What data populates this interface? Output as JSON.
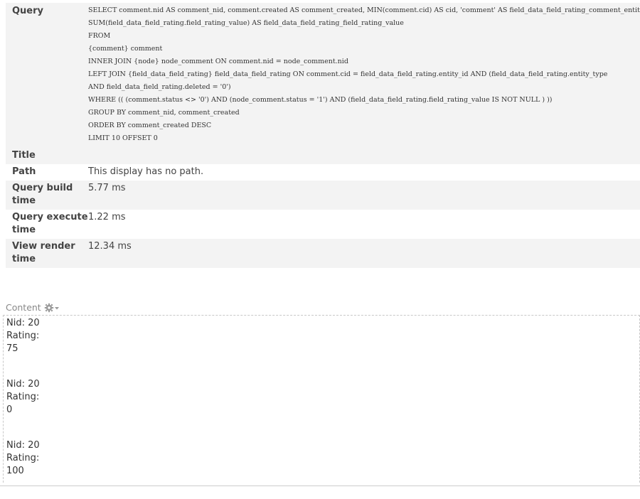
{
  "preview": {
    "rows": [
      {
        "label": "Query",
        "sql": [
          "SELECT comment.nid AS comment_nid, comment.created AS comment_created, MIN(comment.cid) AS cid, 'comment' AS field_data_field_rating_comment_entity_type,",
          "SUM(field_data_field_rating.field_rating_value) AS field_data_field_rating_field_rating_value",
          "FROM",
          "{comment} comment",
          "INNER JOIN {node} node_comment ON comment.nid = node_comment.nid",
          "LEFT JOIN {field_data_field_rating} field_data_field_rating ON comment.cid = field_data_field_rating.entity_id AND (field_data_field_rating.entity_type",
          "AND field_data_field_rating.deleted = '0')",
          "WHERE (( (comment.status <> '0') AND (node_comment.status = '1') AND (field_data_field_rating.field_rating_value IS NOT NULL ) ))",
          "GROUP BY comment_nid, comment_created",
          "ORDER BY comment_created DESC",
          "LIMIT 10 OFFSET 0"
        ]
      },
      {
        "label": "Title",
        "value": ""
      },
      {
        "label": "Path",
        "value": "This display has no path."
      },
      {
        "label": "Query build time",
        "value": "5.77 ms"
      },
      {
        "label": "Query execute time",
        "value": "1.22 ms"
      },
      {
        "label": "View render time",
        "value": "12.34 ms"
      }
    ]
  },
  "content": {
    "label": "Content",
    "settings_icon": "gear-icon",
    "results": [
      {
        "nid_text": "Nid: 20",
        "rating_label": "Rating:",
        "rating_value": "75"
      },
      {
        "nid_text": "Nid: 20",
        "rating_label": "Rating:",
        "rating_value": "0"
      },
      {
        "nid_text": "Nid: 20",
        "rating_label": "Rating:",
        "rating_value": "100"
      }
    ]
  }
}
